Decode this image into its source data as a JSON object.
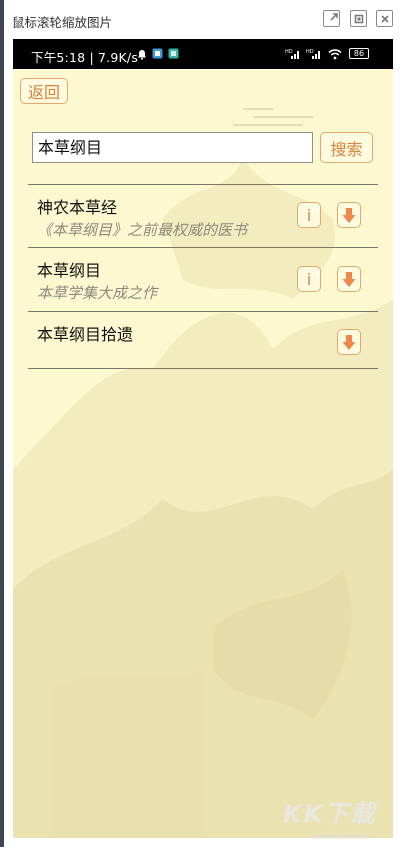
{
  "window": {
    "title": "鼠标滚轮缩放图片",
    "controls": [
      "external-link-icon",
      "restore-icon",
      "close-icon"
    ]
  },
  "status_bar": {
    "text": "下午5:18 | 7.9K/s",
    "icons": [
      "bell-icon",
      "app-icon",
      "app-icon",
      "signal-icon",
      "signal-icon",
      "wifi-icon",
      "battery-icon"
    ],
    "battery": "86"
  },
  "app": {
    "back_label": "返回",
    "search": {
      "value": "本草纲目",
      "button_label": "搜索"
    },
    "results": [
      {
        "title": "神农本草经",
        "subtitle": "《本草纲目》之前最权威的医书",
        "has_info": true,
        "info_label": "i"
      },
      {
        "title": "本草纲目",
        "subtitle": "本草学集大成之作",
        "has_info": true,
        "info_label": "i"
      },
      {
        "title": "本草纲目拾遗",
        "subtitle": "",
        "has_info": false
      }
    ],
    "colors": {
      "accent": "#d9833c",
      "background": "#fdf8cf",
      "arrow": "#f0874a"
    }
  },
  "watermark": {
    "text": "KK下载",
    "url": "www.kkx.net"
  }
}
